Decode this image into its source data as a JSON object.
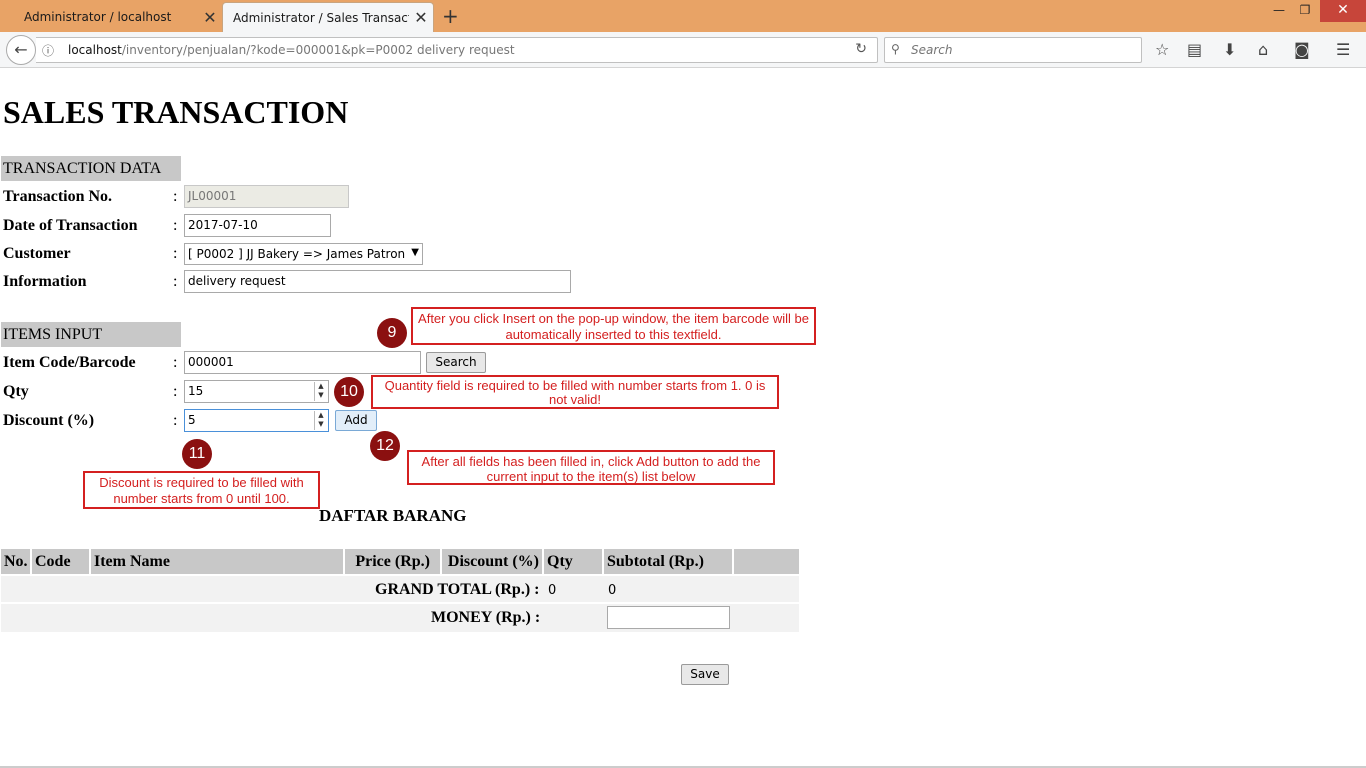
{
  "browser": {
    "tabs": [
      {
        "label": "Administrator / localhost",
        "active": false
      },
      {
        "label": "Administrator / Sales Transaction",
        "active": true
      }
    ],
    "url_host": "localhost",
    "url_path": "/inventory/penjualan/?kode=000001&pk=P0002 delivery request",
    "search_placeholder": "Search"
  },
  "page": {
    "title": "SALES TRANSACTION"
  },
  "transaction": {
    "header": "TRANSACTION DATA",
    "fields": [
      {
        "label": "Transaction No.",
        "value": "JL00001"
      },
      {
        "label": "Date of Transaction",
        "value": "2017-07-10"
      },
      {
        "label": "Customer",
        "value": "[ P0002 ] JJ Bakery => James Patron"
      },
      {
        "label": "Information",
        "value": "delivery request"
      }
    ]
  },
  "items_input": {
    "header": "ITEMS INPUT",
    "code_label": "Item Code/Barcode",
    "code_value": "000001",
    "search_label": "Search",
    "qty_label": "Qty",
    "qty_value": "15",
    "discount_label": "Discount (%)",
    "discount_value": "5",
    "add_label": "Add"
  },
  "annotations": [
    {
      "number": "9",
      "text": "After you click Insert on the pop-up window, the item barcode will be automatically inserted to this textfield."
    },
    {
      "number": "10",
      "text": "Quantity field is required to be filled with number starts from 1. 0 is not valid!"
    },
    {
      "number": "11",
      "text": "Discount is required to be filled with number starts from 0 until 100."
    },
    {
      "number": "12",
      "text": "After all fields has been filled in, click Add button to add the current input to the item(s) list below"
    }
  ],
  "item_list": {
    "title": "DAFTAR BARANG",
    "columns": [
      "No.",
      "Code",
      "Item Name",
      "Price (Rp.)",
      "Discount (%)",
      "Qty",
      "Subtotal (Rp.)"
    ],
    "grand_total_label": "GRAND TOTAL (Rp.) :",
    "grand_total_qty": "0",
    "grand_total_subtotal": "0",
    "money_label": "MONEY (Rp.) :",
    "money_value": ""
  },
  "save_label": "Save",
  "colors": {
    "accent_titlebar": "#e8a366",
    "section_header_bg": "#c8c8c8",
    "annotation_red": "#d42020",
    "badge_dark_red": "#8b1010"
  }
}
